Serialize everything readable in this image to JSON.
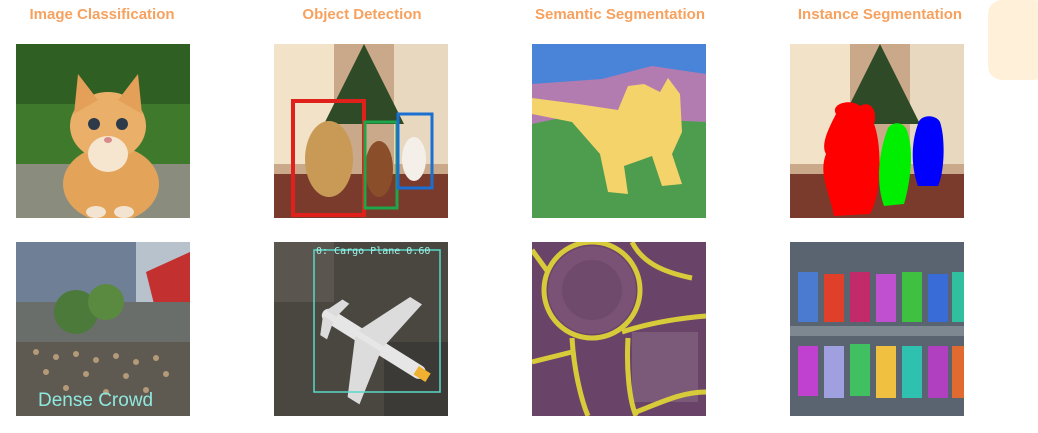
{
  "columns": [
    {
      "title": "Image Classification"
    },
    {
      "title": "Object Detection"
    },
    {
      "title": "Semantic Segmentation"
    },
    {
      "title": "Instance Segmentation"
    }
  ],
  "tiles": {
    "crowd_label": "Dense Crowd",
    "plane_detection_label": "0: Cargo Plane 0.60"
  },
  "colors": {
    "title": "#f7a15f",
    "sky": "#4a84d8",
    "grass": "#4e9d4e",
    "cat_mask": "#f3d36a",
    "mountain": "#b27cb0",
    "road_mask": "#d8cb3a",
    "box_red": "#e0201a",
    "box_green": "#1fa54a",
    "box_blue": "#1a6fd0",
    "inst_red": "#ff0000",
    "inst_green": "#00ee00",
    "inst_blue": "#0000ff"
  }
}
